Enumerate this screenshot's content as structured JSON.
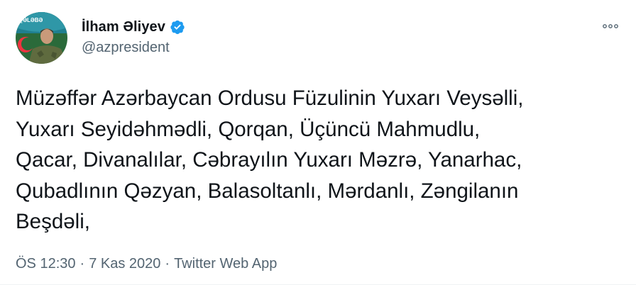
{
  "author": {
    "name": "İlham Əliyev",
    "handle": "@azpresident",
    "verified": true,
    "avatar_text": "QƏLƏBƏ"
  },
  "tweet": {
    "text": "Müzəffər Azərbaycan Ordusu Füzulinin Yuxarı Veysəlli,\nYuxarı Seyidəhmədli, Qorqan, Üçüncü Mahmudlu,\nQacar, Divanalılar, Cəbrayılın Yuxarı Məzrə, Yanarhac,\nQubadlının Qəzyan, Balasoltanlı, Mərdanlı, Zəngilanın\nBeşdəli,"
  },
  "meta": {
    "time": "ÖS 12:30",
    "separator": "·",
    "date": "7 Kas 2020",
    "source": "Twitter Web App"
  },
  "icons": {
    "verified": "verified-badge-icon",
    "more": "more-dots-icon"
  },
  "colors": {
    "text": "#0f1419",
    "secondary": "#536471",
    "verified": "#1d9bf0",
    "flag_blue": "#00b5e2",
    "flag_red": "#ef3340",
    "flag_green": "#509e2f"
  }
}
